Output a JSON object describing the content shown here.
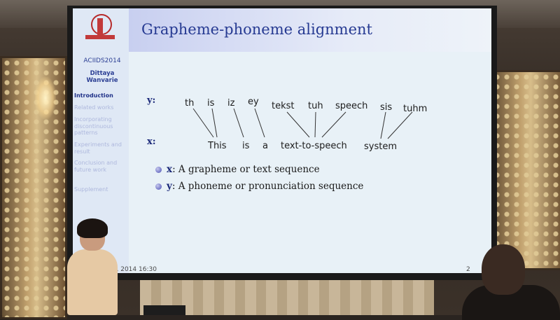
{
  "slide": {
    "title": "Grapheme-phoneme alignment",
    "sidebar": {
      "conference": "ACIIDS2014",
      "author_line1": "Dittaya",
      "author_line2": "Wanvarie",
      "menu": [
        {
          "label": "Introduction",
          "active": true
        },
        {
          "label": "Related works",
          "active": false
        },
        {
          "label": "Incorporating discontinuous patterns",
          "active": false
        },
        {
          "label": "Experiments and result",
          "active": false
        },
        {
          "label": "Conclusion and future work",
          "active": false
        },
        {
          "label": "Supplement",
          "active": false
        }
      ]
    },
    "y_label": "y:",
    "x_label": "x:",
    "phonemes": [
      "th",
      "is",
      "iz",
      "ey",
      "tekst",
      "tuh",
      "speech",
      "sis",
      "tuhm"
    ],
    "graphemes": [
      "This",
      "is",
      "a",
      "text-to-speech",
      "system"
    ],
    "bullets": [
      {
        "var": "x",
        "text": ": A grapheme or text sequence"
      },
      {
        "var": "y",
        "text": ": A phoneme or pronunciation sequence"
      }
    ],
    "footer_left": "l, 2014 16:30",
    "footer_right": "2"
  },
  "colors": {
    "title": "#263a92",
    "slide_bg": "#e8f1f7",
    "sidebar_bg": "#dfe8f5"
  }
}
